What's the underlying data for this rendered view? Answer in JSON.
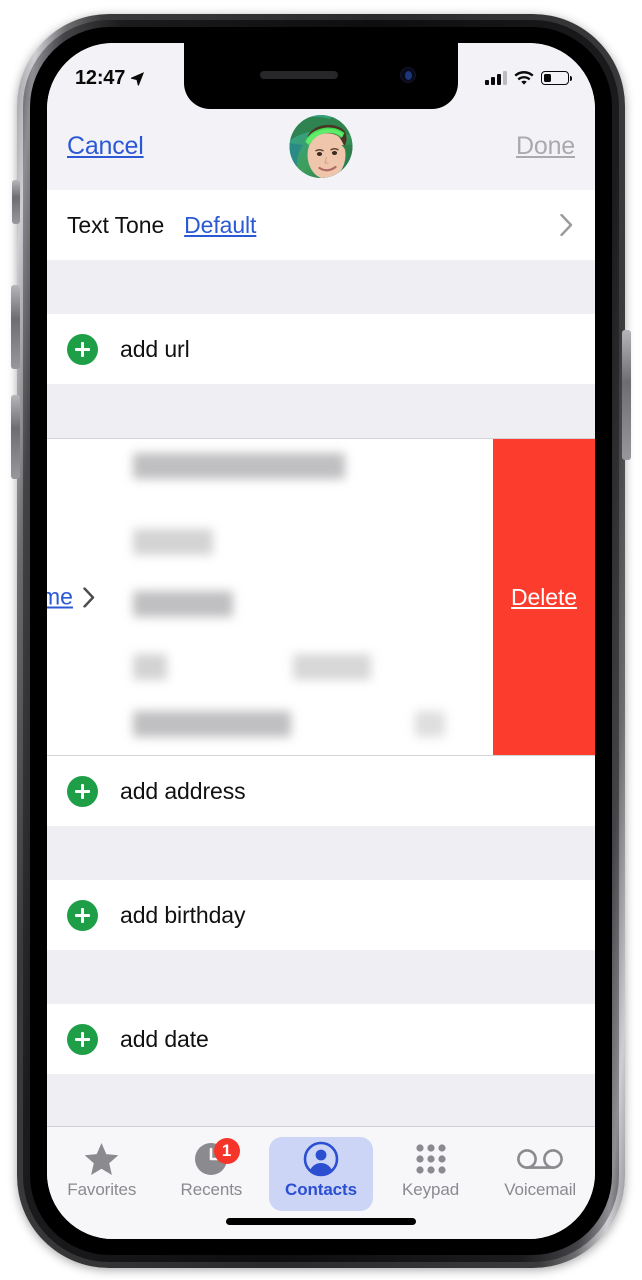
{
  "status_bar": {
    "time": "12:47",
    "location_icon": "location-arrow-icon",
    "signal_icon": "cellular-signal-icon",
    "wifi_icon": "wifi-icon",
    "battery_icon": "battery-icon",
    "battery_level_percent": 32
  },
  "nav_bar": {
    "cancel_label": "Cancel",
    "done_label": "Done",
    "done_disabled": true,
    "avatar_name": "contact-avatar"
  },
  "colors": {
    "link_blue": "#2b59d6",
    "delete_red": "#fc3d2e",
    "add_green": "#1e9e47",
    "selected_tab_blue": "#2b4fd0",
    "selected_tab_bg": "#ccd5f6",
    "badge_red": "#f5352a",
    "group_bg": "#eeeef3"
  },
  "form": {
    "text_tone": {
      "label": "Text Tone",
      "value": "Default",
      "chevron_icon": "chevron-right-icon"
    },
    "add_url": {
      "label": "add url",
      "icon": "plus-circle-icon"
    },
    "address_row": {
      "type_label": "me",
      "type_label_full": "home",
      "chevron_icon": "chevron-right-icon",
      "content_redacted": true,
      "delete_label": "Delete"
    },
    "add_address": {
      "label": "add address",
      "icon": "plus-circle-icon"
    },
    "add_birthday": {
      "label": "add birthday",
      "icon": "plus-circle-icon"
    },
    "add_date": {
      "label": "add date",
      "icon": "plus-circle-icon"
    }
  },
  "tab_bar": {
    "tabs": [
      {
        "label": "Favorites",
        "icon": "star-icon",
        "selected": false,
        "badge": null
      },
      {
        "label": "Recents",
        "icon": "clock-icon",
        "selected": false,
        "badge": "1"
      },
      {
        "label": "Contacts",
        "icon": "person-circle-icon",
        "selected": true,
        "badge": null
      },
      {
        "label": "Keypad",
        "icon": "keypad-dots-icon",
        "selected": false,
        "badge": null
      },
      {
        "label": "Voicemail",
        "icon": "voicemail-icon",
        "selected": false,
        "badge": null
      }
    ]
  }
}
